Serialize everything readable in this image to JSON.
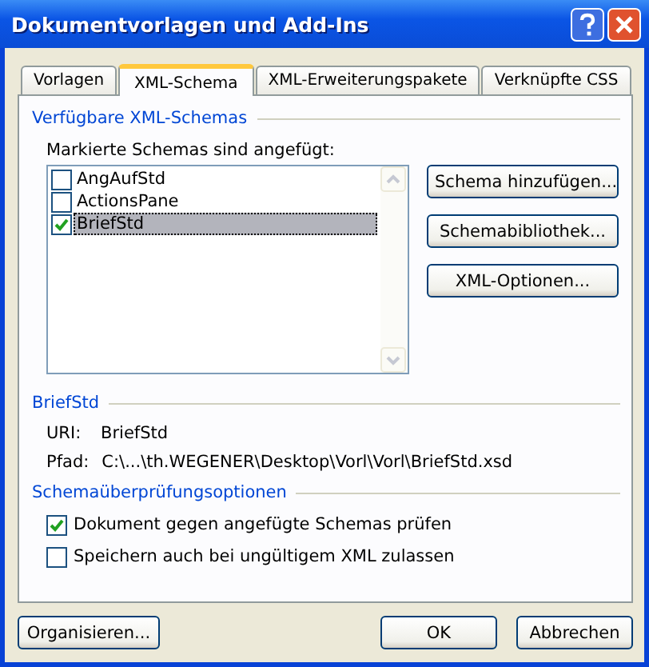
{
  "window": {
    "title": "Dokumentvorlagen und Add-Ins"
  },
  "tabs": [
    {
      "label": "Vorlagen",
      "selected": false
    },
    {
      "label": "XML-Schema",
      "selected": true
    },
    {
      "label": "XML-Erweiterungspakete",
      "selected": false
    },
    {
      "label": "Verknüpfte CSS",
      "selected": false
    }
  ],
  "schemas": {
    "heading": "Verfügbare XML-Schemas",
    "list_label": "Markierte Schemas sind angefügt:",
    "items": [
      {
        "label": "AngAufStd",
        "checked": false,
        "selected": false
      },
      {
        "label": "ActionsPane",
        "checked": false,
        "selected": false
      },
      {
        "label": "BriefStd",
        "checked": true,
        "selected": true
      }
    ],
    "buttons": [
      "Schema hinzufügen...",
      "Schemabibliothek...",
      "XML-Optionen..."
    ]
  },
  "details": {
    "heading": "BriefStd",
    "rows": [
      {
        "label": "URI:",
        "value": "BriefStd"
      },
      {
        "label": "Pfad:",
        "value": "C:\\...\\th.WEGENER\\Desktop\\Vorl\\Vorl\\BriefStd.xsd"
      }
    ]
  },
  "validation": {
    "heading": "Schemaüberprüfungsoptionen",
    "options": [
      {
        "label": "Dokument gegen angefügte Schemas prüfen",
        "checked": true
      },
      {
        "label": "Speichern auch bei ungültigem XML zulassen",
        "checked": false
      }
    ]
  },
  "footer": {
    "left_button": "Organisieren...",
    "buttons": [
      "OK",
      "Abbrechen"
    ]
  }
}
